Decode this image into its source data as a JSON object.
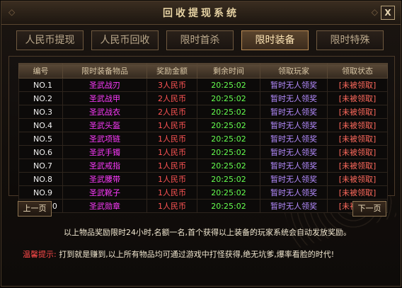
{
  "window": {
    "title": "回收提现系统",
    "close_label": "X"
  },
  "tabs": [
    {
      "label": "人民币提现"
    },
    {
      "label": "人民币回收"
    },
    {
      "label": "限时首杀"
    },
    {
      "label": "限时装备",
      "active": true
    },
    {
      "label": "限时特殊"
    }
  ],
  "table": {
    "headers": [
      "编号",
      "限时装备物品",
      "奖励金额",
      "剩余时间",
      "领取玩家",
      "领取状态"
    ],
    "rows": [
      {
        "id": "NO.1",
        "item": "圣武战刃",
        "amount": "3人民币",
        "time": "20:25:02",
        "player": "暂时无人领奖",
        "status": "[未被领取]"
      },
      {
        "id": "NO.2",
        "item": "圣武战甲",
        "amount": "2人民币",
        "time": "20:25:02",
        "player": "暂时无人领奖",
        "status": "[未被领取]"
      },
      {
        "id": "NO.3",
        "item": "圣武战衣",
        "amount": "2人民币",
        "time": "20:25:02",
        "player": "暂时无人领奖",
        "status": "[未被领取]"
      },
      {
        "id": "NO.4",
        "item": "圣武头盔",
        "amount": "1人民币",
        "time": "20:25:02",
        "player": "暂时无人领奖",
        "status": "[未被领取]"
      },
      {
        "id": "NO.5",
        "item": "圣武项链",
        "amount": "1人民币",
        "time": "20:25:02",
        "player": "暂时无人领奖",
        "status": "[未被领取]"
      },
      {
        "id": "NO.6",
        "item": "圣武手镯",
        "amount": "1人民币",
        "time": "20:25:02",
        "player": "暂时无人领奖",
        "status": "[未被领取]"
      },
      {
        "id": "NO.7",
        "item": "圣武戒指",
        "amount": "1人民币",
        "time": "20:25:02",
        "player": "暂时无人领奖",
        "status": "[未被领取]"
      },
      {
        "id": "NO.8",
        "item": "圣武腰带",
        "amount": "1人民币",
        "time": "20:25:02",
        "player": "暂时无人领奖",
        "status": "[未被领取]"
      },
      {
        "id": "NO.9",
        "item": "圣武靴子",
        "amount": "1人民币",
        "time": "20:25:02",
        "player": "暂时无人领奖",
        "status": "[未被领取]"
      },
      {
        "id": "NO.10",
        "item": "圣武勋章",
        "amount": "1人民币",
        "time": "20:25:02",
        "player": "暂时无人领奖",
        "status": "[未被领取]"
      }
    ]
  },
  "pagination": {
    "prev_label": "上一页",
    "next_label": "下一页"
  },
  "description": "以上物品奖励限时24小时,名额一名,首个获得以上装备的玩家系统会自动发放奖励。",
  "tip": {
    "label": "温馨提示:",
    "text": "打到就是赚到,以上所有物品均可通过游戏中打怪获得,绝无坑爹,爆率看脸的时代!"
  }
}
